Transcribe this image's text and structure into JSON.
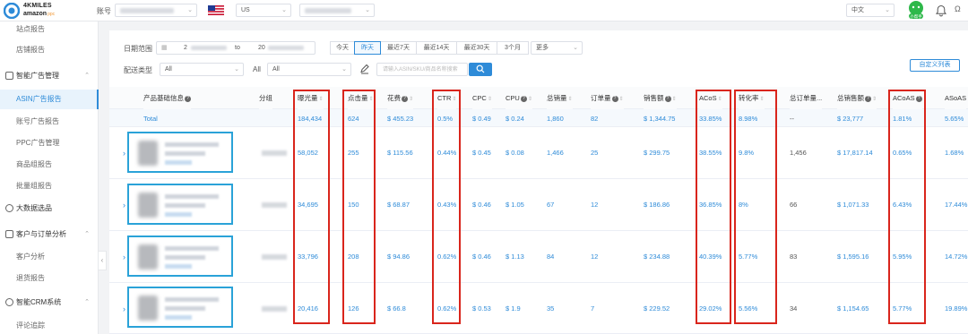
{
  "topbar": {
    "logo_line1": "4KMILES",
    "logo_line2": "amazon",
    "logo_sub": "ppc",
    "account_label": "账号",
    "marketplace": "US",
    "language": "中文",
    "help_label": "小帮手",
    "user_initial": "Ω"
  },
  "sidebar": {
    "items": [
      {
        "label": "站点报告"
      },
      {
        "label": "店铺报告"
      },
      {
        "label": "智能广告管理"
      },
      {
        "label": "ASIN广告报告"
      },
      {
        "label": "账号广告报告"
      },
      {
        "label": "PPC广告管理"
      },
      {
        "label": "商品组报告"
      },
      {
        "label": "批量组报告"
      },
      {
        "label": "大数据选品"
      },
      {
        "label": "客户与订单分析"
      },
      {
        "label": "客户分析"
      },
      {
        "label": "退货报告"
      },
      {
        "label": "智能CRM系统"
      },
      {
        "label": "评论追踪"
      }
    ],
    "collapse_glyph": "‹"
  },
  "filters": {
    "date_label": "日期范围",
    "date_from": "2",
    "date_to_word": "to",
    "date_to": "20",
    "quick_ranges": [
      "今天",
      "昨天",
      "最近7天",
      "最近14天",
      "最近30天",
      "3个月",
      "更多"
    ],
    "active_range": "昨天",
    "type_label": "配送类型",
    "type_value": "All",
    "all_label": "All",
    "all_value": "All",
    "search_placeholder": "请输入ASIN/SKU/商品名称搜索",
    "columns_button": "自定义列表"
  },
  "table": {
    "headers": [
      "产品基础信息",
      "分组",
      "曝光量",
      "点击量",
      "花费",
      "CTR",
      "CPC",
      "CPU",
      "总销量",
      "订单量",
      "销售额",
      "ACoS",
      "转化率",
      "总订单量...",
      "总销售额",
      "ACoAS",
      "ASoAS"
    ],
    "total_label": "Total",
    "total": [
      "184,434",
      "624",
      "$ 455.23",
      "0.5%",
      "$ 0.49",
      "$ 0.24",
      "1,860",
      "82",
      "$ 1,344.75",
      "33.85%",
      "8.98%",
      "--",
      "$ 23,777",
      "1.81%",
      "5.65%"
    ],
    "rows": [
      [
        "58,052",
        "255",
        "$ 115.56",
        "0.44%",
        "$ 0.45",
        "$ 0.08",
        "1,466",
        "25",
        "$ 299.75",
        "38.55%",
        "9.8%",
        "1,456",
        "$ 17,817.14",
        "0.65%",
        "1.68%"
      ],
      [
        "34,695",
        "150",
        "$ 68.87",
        "0.43%",
        "$ 0.46",
        "$ 1.05",
        "67",
        "12",
        "$ 186.86",
        "36.85%",
        "8%",
        "66",
        "$ 1,071.33",
        "6.43%",
        "17.44%"
      ],
      [
        "33,796",
        "208",
        "$ 94.86",
        "0.62%",
        "$ 0.46",
        "$ 1.13",
        "84",
        "12",
        "$ 234.88",
        "40.39%",
        "5.77%",
        "83",
        "$ 1,595.16",
        "5.95%",
        "14.72%"
      ],
      [
        "20,416",
        "126",
        "$ 66.8",
        "0.62%",
        "$ 0.53",
        "$ 1.9",
        "35",
        "7",
        "$ 229.52",
        "29.02%",
        "5.56%",
        "34",
        "$ 1,154.65",
        "5.77%",
        "19.89%"
      ]
    ]
  },
  "colors": {
    "accent": "#2e8bd8",
    "highlight_red": "#d9251c",
    "product_box": "#2aa2d8",
    "help_green": "#2eb84a"
  }
}
